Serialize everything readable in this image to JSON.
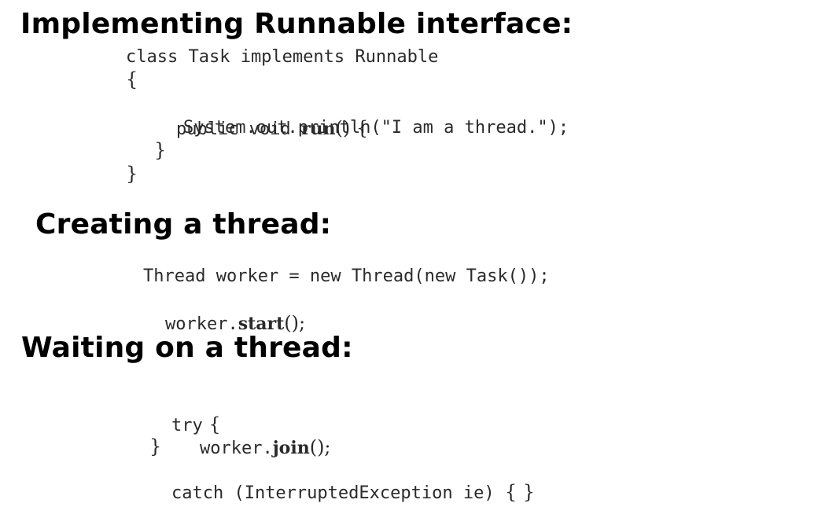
{
  "sections": [
    {
      "heading": "Implementing Runnable interface:",
      "code": {
        "l1": "class Task implements Runnable",
        "l2_brace": "{",
        "l3_pre": "public void ",
        "l3_bold": "run",
        "l3_post": "() {",
        "l4": "System.out.println(\"I am a thread.\");",
        "l5_brace": "}",
        "l6_brace": "}"
      }
    },
    {
      "heading": "Creating a thread:",
      "code": {
        "l1": "Thread worker = new Thread(new Task());",
        "l2_pre": "worker.",
        "l2_bold": "start",
        "l2_post": "();"
      }
    },
    {
      "heading": "Waiting on a thread:",
      "code": {
        "l1_kw": "try",
        "l1_brace": " {",
        "l2_pre": "worker.",
        "l2_bold": "join",
        "l2_post": "();",
        "l3_brace": "}",
        "l4_kw": "catch (InterruptedException ie) ",
        "l4_braces": "{ }"
      }
    }
  ]
}
